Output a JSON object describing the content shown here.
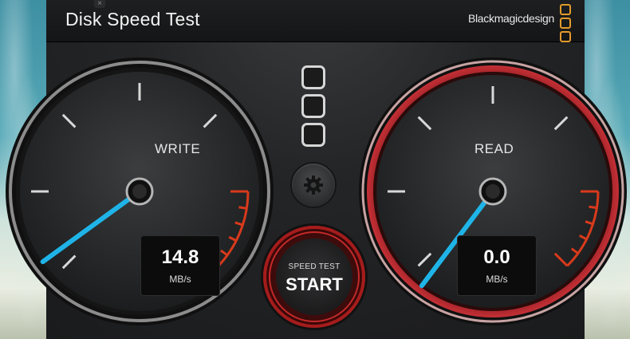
{
  "window": {
    "title": "Disk Speed Test",
    "brand": "Blackmagicdesign",
    "close_label": "×"
  },
  "write_gauge": {
    "label": "WRITE",
    "value": "14.8",
    "unit": "MB/s",
    "needle_color": "#1fb4e8"
  },
  "read_gauge": {
    "label": "READ",
    "value": "0.0",
    "unit": "MB/s",
    "needle_color": "#1fb4e8",
    "ring_color": "#b3262b"
  },
  "start_button": {
    "top_label": "SPEED TEST",
    "main_label": "START"
  },
  "icons": {
    "settings": "gear-icon",
    "logo": "blackmagic-logo-icon"
  },
  "colors": {
    "accent_orange": "#e39a2c",
    "red_zone": "#d83a1c"
  }
}
